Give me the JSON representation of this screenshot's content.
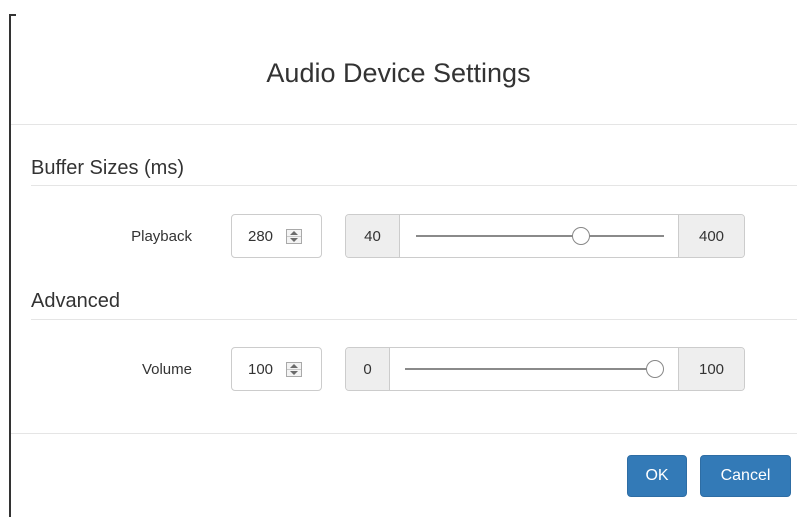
{
  "dialog": {
    "title": "Audio Device Settings",
    "accent_color": "#337ab7"
  },
  "sections": {
    "buffer": {
      "title": "Buffer Sizes (ms)",
      "playback": {
        "label": "Playback",
        "value": "280",
        "min_label": "40",
        "max_label": "400",
        "slider_value": 280,
        "slider_min": 40,
        "slider_max": 400
      }
    },
    "advanced": {
      "title": "Advanced",
      "volume": {
        "label": "Volume",
        "value": "100",
        "min_label": "0",
        "max_label": "100",
        "slider_value": 100,
        "slider_min": 0,
        "slider_max": 100
      }
    }
  },
  "footer": {
    "ok_label": "OK",
    "cancel_label": "Cancel"
  }
}
